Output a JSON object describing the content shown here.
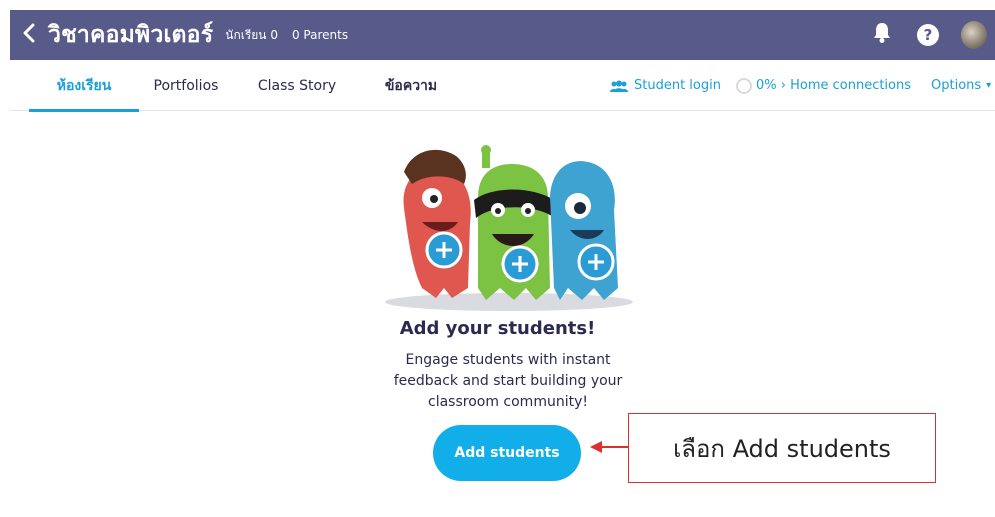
{
  "header": {
    "class_title": "วิชาคอมพิวเตอร์",
    "students_count": "นักเรียน 0",
    "parents_count": "0 Parents",
    "bg_color": "#585a8a"
  },
  "tabs": [
    {
      "label": "ห้องเรียน",
      "active": true
    },
    {
      "label": "Portfolios",
      "active": false
    },
    {
      "label": "Class Story",
      "active": false
    },
    {
      "label": "ข้อความ",
      "active": false
    }
  ],
  "tools": {
    "student_login": "Student login",
    "home_connections": "0% › Home connections",
    "options": "Options"
  },
  "icons": {
    "back": "chevron-left-icon",
    "notifications": "bell-icon",
    "help": "question-icon",
    "profile": "avatar"
  },
  "empty_state": {
    "heading": "Add your students!",
    "description": "Engage students with instant feedback and start building your classroom community!",
    "button_label": "Add students"
  },
  "annotation": {
    "text": "เลือก Add students",
    "color": "#d93030"
  },
  "accent_color": "#1aa0d8",
  "button_color": "#11aee9"
}
